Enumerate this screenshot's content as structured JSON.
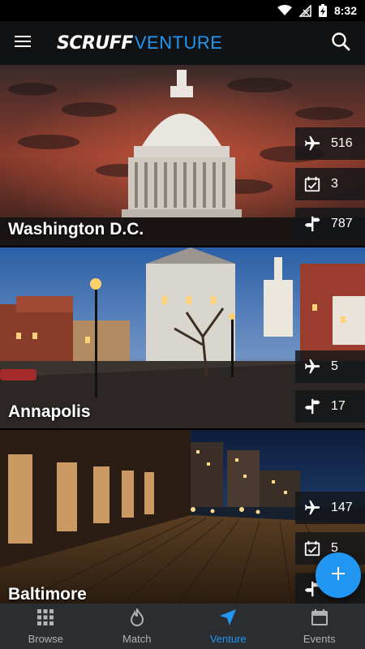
{
  "status_bar": {
    "time": "8:32"
  },
  "app_bar": {
    "logo_primary": "SCRUFF",
    "logo_secondary": "VENTURE"
  },
  "cities": [
    {
      "name": "Washington D.C.",
      "flights": "516",
      "events": "3",
      "guides": "787"
    },
    {
      "name": "Annapolis",
      "flights": "5",
      "guides": "17"
    },
    {
      "name": "Baltimore",
      "flights": "147",
      "events": "5"
    }
  ],
  "bottom_nav": [
    {
      "label": "Browse",
      "icon": "grid-icon"
    },
    {
      "label": "Match",
      "icon": "flame-icon"
    },
    {
      "label": "Venture",
      "icon": "navigation-arrow-icon",
      "active": true
    },
    {
      "label": "Events",
      "icon": "calendar-icon"
    }
  ],
  "colors": {
    "accent": "#2196f3",
    "app_bar": "#111214",
    "bottom_nav": "#2b2d31"
  }
}
